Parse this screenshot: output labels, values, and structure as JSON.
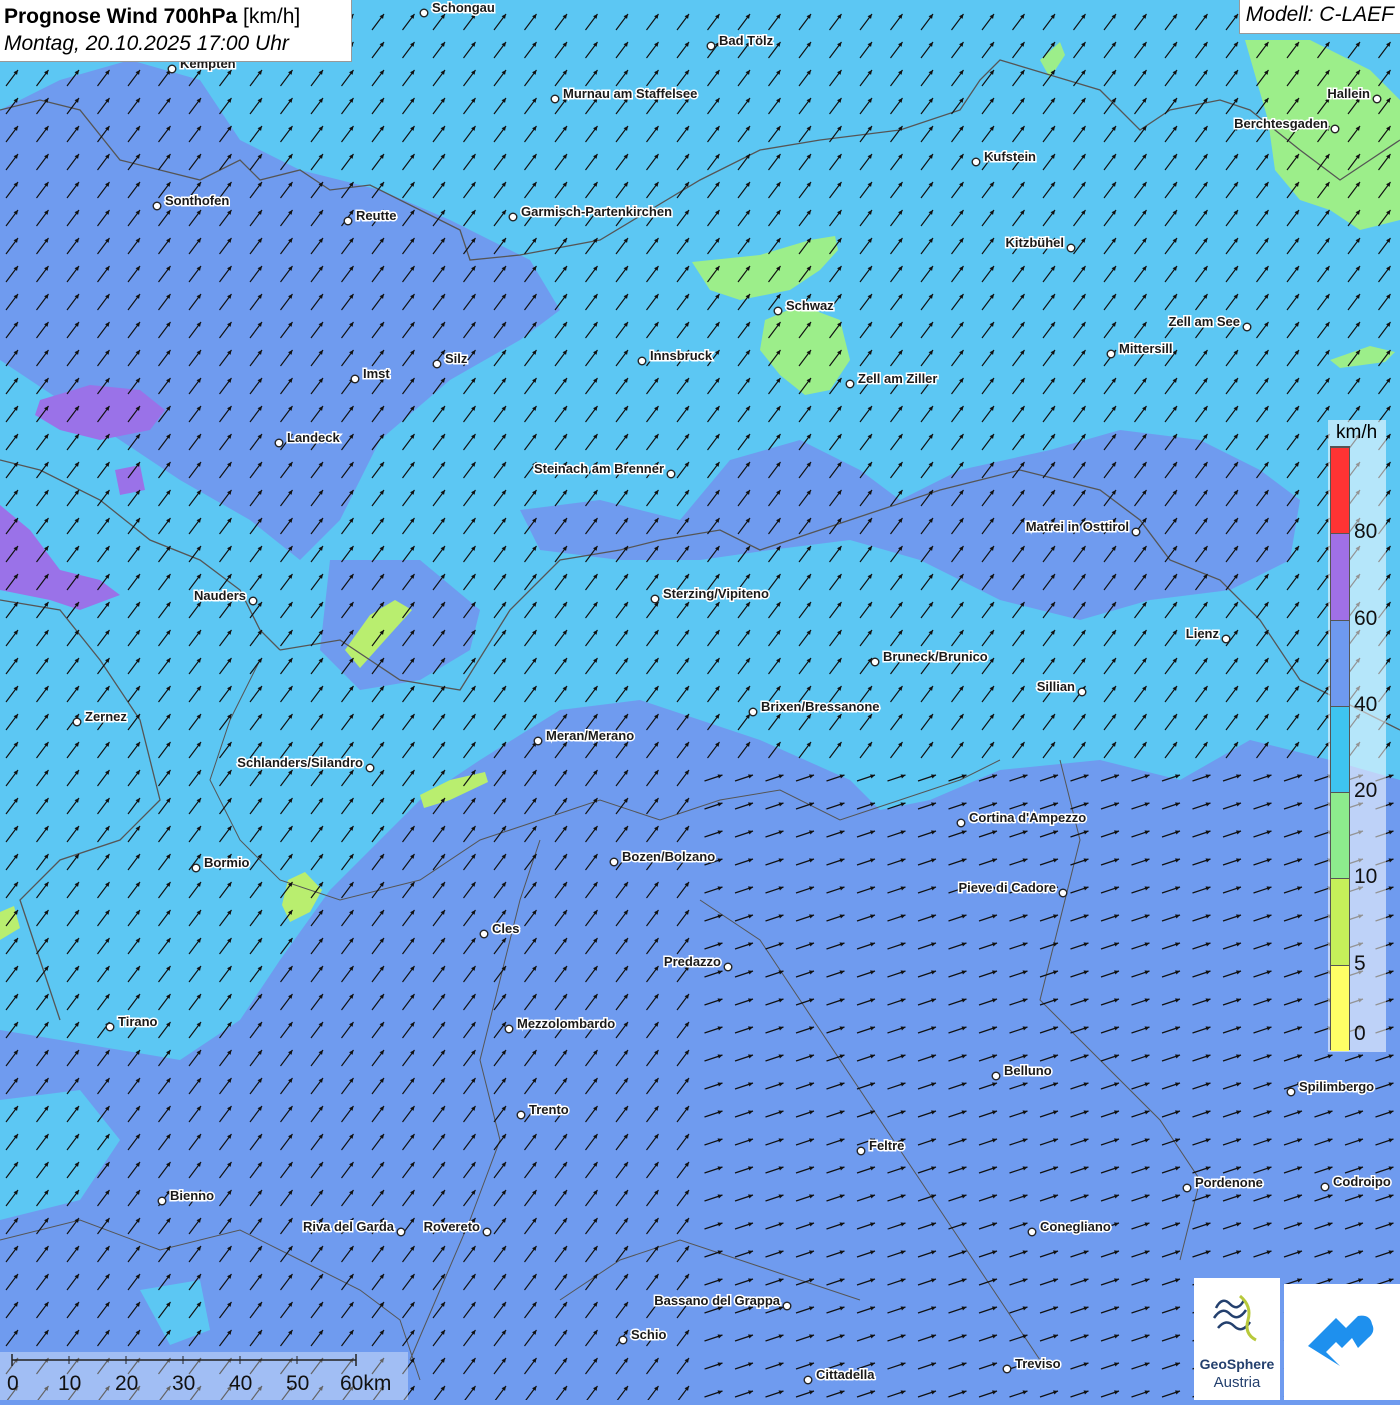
{
  "header": {
    "title_bold": "Prognose Wind 700hPa",
    "title_unit": " [km/h]",
    "datetime": "Montag, 20.10.2025 17:00 Uhr"
  },
  "model_label": "Modell: C-LAEF",
  "legend": {
    "unit": "km/h",
    "ticks": [
      "80",
      "60",
      "40",
      "20",
      "10",
      "5",
      "0"
    ],
    "colors": [
      "#ff3333",
      "#a070e6",
      "#6e99ef",
      "#3ec4f0",
      "#8deb8d",
      "#c6ef5a",
      "#ffff66"
    ]
  },
  "scale": {
    "labels": [
      "0",
      "10",
      "20",
      "30",
      "40",
      "50",
      "60km"
    ]
  },
  "colors": {
    "background": "#6f9bef",
    "wind_light": "#5cc7f3",
    "wind_mid": "#6f9bef",
    "wind_strong": "#9a72e8",
    "wind_calm": "#9cee8a",
    "border": "#555555",
    "arrow": "#111111"
  },
  "wind": {
    "direction": "north-east"
  },
  "cities": [
    "Schongau",
    "Bad Tölz",
    "Kempten",
    "Murnau am Staffelsee",
    "Hallein",
    "Berchtesgaden",
    "Kufstein",
    "Sonthofen",
    "Reutte",
    "Garmisch-Partenkirchen",
    "Kitzbühel",
    "Schwaz",
    "Zell am See",
    "Mittersill",
    "Innsbruck",
    "Silz",
    "Imst",
    "Zell am Ziller",
    "Landeck",
    "Steinach am Brenner",
    "Matrei in Osttirol",
    "Nauders",
    "Sterzing/Vipiteno",
    "Lienz",
    "Bruneck/Brunico",
    "Sillian",
    "Brixen/Bressanone",
    "Zernez",
    "Meran/Merano",
    "Schlanders/Silandro",
    "Cortina d'Ampezzo",
    "Bozen/Bolzano",
    "Bormio",
    "Pieve di Cadore",
    "Cles",
    "Predazzo",
    "Tirano",
    "Mezzolombardo",
    "Belluno",
    "Spilimbergo",
    "Trento",
    "Feltre",
    "Pordenone",
    "Codroipo",
    "Bienno",
    "Riva del Garda",
    "Rovereto",
    "Conegliano",
    "Bassano del Grappa",
    "Schio",
    "Treviso",
    "Cittadella"
  ],
  "logos": {
    "geosphere_line1": "GeoSphere",
    "geosphere_line2": "Austria",
    "geosphere_icon": "geosphere-waves-icon",
    "app_icon": "app-wind-icon"
  }
}
